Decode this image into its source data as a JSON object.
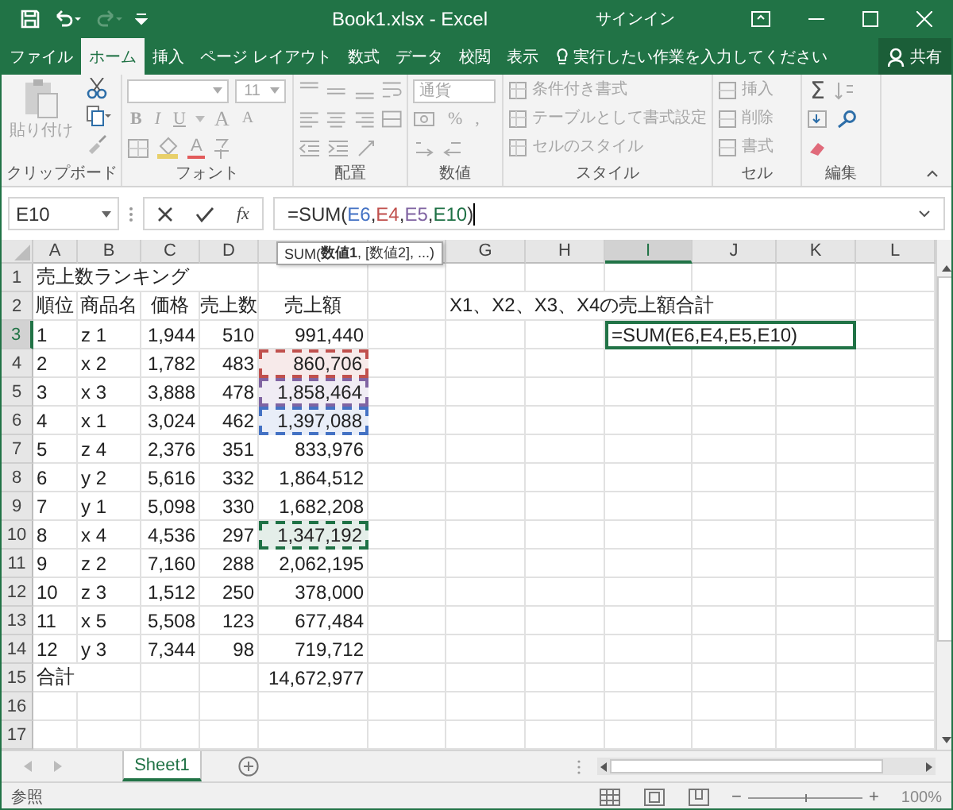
{
  "title_bar": {
    "title": "Book1.xlsx  -  Excel",
    "sign_in": "サインイン"
  },
  "ribbon_tabs": [
    {
      "label": "ファイル",
      "selected": false
    },
    {
      "label": "ホーム",
      "selected": true
    },
    {
      "label": "挿入",
      "selected": false
    },
    {
      "label": "ページ レイアウト",
      "selected": false
    },
    {
      "label": "数式",
      "selected": false
    },
    {
      "label": "データ",
      "selected": false
    },
    {
      "label": "校閲",
      "selected": false
    },
    {
      "label": "表示",
      "selected": false
    }
  ],
  "tell_me": {
    "placeholder": "実行したい作業を入力してください"
  },
  "share_button": "共有",
  "ribbon": {
    "clipboard": {
      "paste": "貼り付け",
      "label": "クリップボード"
    },
    "font": {
      "size": "11",
      "bold": "B",
      "italic": "I",
      "underline": "U",
      "grow": "A",
      "shrink": "A",
      "font_color": "A",
      "label": "フォント"
    },
    "alignment": {
      "label": "配置"
    },
    "number": {
      "format": "通貨",
      "percent": "%",
      "comma": ",",
      "label": "数値"
    },
    "styles": {
      "items": [
        "条件付き書式",
        "テーブルとして書式設定",
        "セルのスタイル"
      ],
      "label": "スタイル"
    },
    "cells": {
      "items": [
        "挿入",
        "削除",
        "書式"
      ],
      "label": "セル"
    },
    "editing": {
      "sum": "Σ",
      "label": "編集"
    }
  },
  "name_box": "E10",
  "function_button": "fx",
  "formula_bar": {
    "segments": [
      {
        "text": "=SUM("
      },
      {
        "text": "E6",
        "color": "#4472c4"
      },
      {
        "text": ","
      },
      {
        "text": "E4",
        "color": "#c0504d"
      },
      {
        "text": ","
      },
      {
        "text": "E5",
        "color": "#8064a2"
      },
      {
        "text": ","
      },
      {
        "text": "E10",
        "color": "#1e7145"
      },
      {
        "text": ")"
      }
    ]
  },
  "tooltip": "SUM(**数値1**, [数値2], ...)",
  "columns": [
    {
      "label": "A",
      "selected": false
    },
    {
      "label": "B",
      "selected": false
    },
    {
      "label": "C",
      "selected": false
    },
    {
      "label": "D",
      "selected": false
    },
    {
      "selected": false
    },
    {
      "selected": false
    },
    {
      "label": "G",
      "selected": false
    },
    {
      "label": "H",
      "selected": false
    },
    {
      "label": "I",
      "selected": true
    },
    {
      "label": "J",
      "selected": false
    },
    {
      "label": "K",
      "selected": false
    },
    {
      "label": "L",
      "selected": false
    }
  ],
  "rows": [
    {
      "header": "1",
      "selected": false,
      "kind": "title",
      "cells": [
        "売上数ランキング"
      ]
    },
    {
      "header": "2",
      "selected": false,
      "kind": "header",
      "cells": [
        "順位",
        "商品名",
        "価格",
        "売上数",
        "売上額",
        null,
        "X1、X2、X3、X4の売上額合計"
      ]
    },
    {
      "header": "3",
      "selected": true,
      "kind": "data",
      "cells": [
        "1",
        "z 1",
        "1,944",
        "510",
        "991,440",
        null,
        null,
        null,
        {
          "text": "=SUM(E6,E4,E5,E10)",
          "active": true
        }
      ]
    },
    {
      "header": "4",
      "selected": false,
      "kind": "data",
      "cells": [
        "2",
        "x 2",
        "1,782",
        "483",
        {
          "text": "860,706",
          "color": "#c0504d"
        }
      ]
    },
    {
      "header": "5",
      "selected": false,
      "kind": "data",
      "cells": [
        "3",
        "x 3",
        "3,888",
        "478",
        {
          "text": "1,858,464",
          "color": "#8064a2"
        }
      ]
    },
    {
      "header": "6",
      "selected": false,
      "kind": "data",
      "cells": [
        "4",
        "x 1",
        "3,024",
        "462",
        {
          "text": "1,397,088",
          "color": "#4472c4"
        }
      ]
    },
    {
      "header": "7",
      "selected": false,
      "kind": "data",
      "cells": [
        "5",
        "z 4",
        "2,376",
        "351",
        "833,976"
      ]
    },
    {
      "header": "8",
      "selected": false,
      "kind": "data",
      "cells": [
        "6",
        "y 2",
        "5,616",
        "332",
        "1,864,512"
      ]
    },
    {
      "header": "9",
      "selected": false,
      "kind": "data",
      "cells": [
        "7",
        "y 1",
        "5,098",
        "330",
        "1,682,208"
      ]
    },
    {
      "header": "10",
      "selected": false,
      "kind": "data",
      "cells": [
        "8",
        "x 4",
        "4,536",
        "297",
        {
          "text": "1,347,192",
          "color": "#1e7145"
        }
      ]
    },
    {
      "header": "11",
      "selected": false,
      "kind": "data",
      "cells": [
        "9",
        "z 2",
        "7,160",
        "288",
        "2,062,195"
      ]
    },
    {
      "header": "12",
      "selected": false,
      "kind": "data",
      "cells": [
        "10",
        "z 3",
        "1,512",
        "250",
        "378,000"
      ]
    },
    {
      "header": "13",
      "selected": false,
      "kind": "data",
      "cells": [
        "11",
        "x 5",
        "5,508",
        "123",
        "677,484"
      ]
    },
    {
      "header": "14",
      "selected": false,
      "kind": "data",
      "cells": [
        "12",
        "y 3",
        "7,344",
        "98",
        "719,712"
      ]
    },
    {
      "header": "15",
      "selected": false,
      "kind": "total",
      "cells": [
        "合計",
        null,
        null,
        null,
        "14,672,977"
      ]
    },
    {
      "header": "16",
      "selected": false,
      "kind": "blank"
    },
    {
      "header": "17",
      "selected": false,
      "kind": "blank"
    }
  ],
  "sheet_tabs": [
    {
      "label": "Sheet1",
      "selected": true
    }
  ],
  "status_bar": {
    "mode": "参照",
    "zoom_out": "−",
    "zoom_slider": {
      "level": 0.5
    },
    "zoom_in": "+",
    "zoom": "100%"
  }
}
